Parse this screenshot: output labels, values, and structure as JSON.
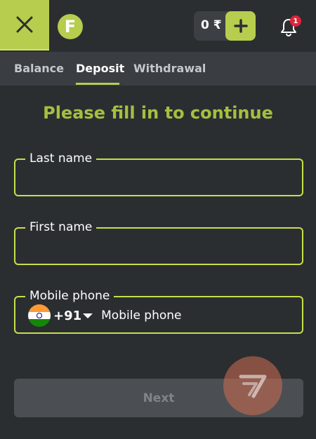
{
  "header": {
    "logo_letter": "F",
    "balance": "0 ₹",
    "notification_count": "1"
  },
  "tabs": [
    {
      "label": "Balance",
      "active": false
    },
    {
      "label": "Deposit",
      "active": true
    },
    {
      "label": "Withdrawal",
      "active": false
    }
  ],
  "form": {
    "heading": "Please fill in to continue",
    "last_name": {
      "label": "Last name",
      "value": ""
    },
    "first_name": {
      "label": "First name",
      "value": ""
    },
    "mobile_phone": {
      "label": "Mobile phone",
      "dial_code": "+91",
      "placeholder": "Mobile phone",
      "country_flag": "india-flag-icon"
    },
    "next_label": "Next"
  },
  "colors": {
    "accent": "#b6cd4e",
    "field_border": "#c5e04a",
    "heading": "#a4c040",
    "background": "#2b2e31",
    "tabs_bg": "#3a3e42",
    "badge": "#e0233c"
  }
}
